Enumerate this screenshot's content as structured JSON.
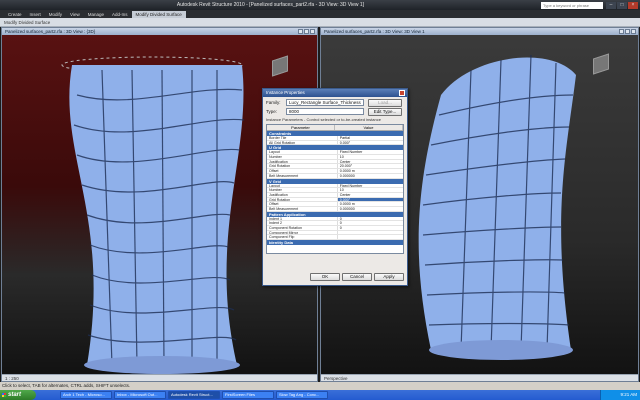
{
  "window": {
    "title": "Autodesk Revit Structure 2010 - [Panelized surfaces_part2.rfa - 3D View: 3D View 1]",
    "search_placeholder": "Type a keyword or phrase"
  },
  "ribbon": {
    "tabs": [
      "Create",
      "Insert",
      "Modify",
      "View",
      "Manage",
      "Add-Ins",
      "Modify Divided Surface"
    ]
  },
  "context_label": "Modify Divided Surface",
  "viewports": {
    "left": {
      "title": "Panelized surfaces_part2.rfa : 3D View : {3D}",
      "scale": "1 : 250"
    },
    "right": {
      "title": "Panelized surfaces_part2.rfa : 3D View: 3D View 1",
      "mode": "Perspective"
    }
  },
  "dialog": {
    "title": "Instance Properties",
    "family_label": "Family:",
    "family_value": "Lucy_Rectangle Surface_Thickness",
    "load_button": "Load...",
    "type_label": "Type:",
    "type_value": "8000",
    "edit_type_button": "Edit Type...",
    "note": "Instance Parameters - Control selected or to-be-created instance",
    "col_parameter": "Parameter",
    "col_value": "Value",
    "sections": [
      {
        "name": "Constraints",
        "rows": [
          {
            "p": "Border Tile",
            "v": "Partial"
          },
          {
            "p": "All Grid Rotation",
            "v": "0.000°"
          }
        ]
      },
      {
        "name": "U Grid",
        "rows": [
          {
            "p": "Layout",
            "v": "Fixed Number"
          },
          {
            "p": "Number",
            "v": "10"
          },
          {
            "p": "Justification",
            "v": "Center"
          },
          {
            "p": "Grid Rotation",
            "v": "20.000°"
          },
          {
            "p": "Offset",
            "v": "0.0000 m"
          },
          {
            "p": "Belt Measurement",
            "v": "0.000000"
          }
        ]
      },
      {
        "name": "V Grid",
        "rows": [
          {
            "p": "Layout",
            "v": "Fixed Number"
          },
          {
            "p": "Number",
            "v": "10"
          },
          {
            "p": "Justification",
            "v": "Center"
          },
          {
            "p": "Grid Rotation",
            "v": "0.000°",
            "selected": true
          },
          {
            "p": "Offset",
            "v": "0.0000 m"
          },
          {
            "p": "Belt Measurement",
            "v": "0.000000"
          }
        ]
      },
      {
        "name": "Pattern Application",
        "rows": [
          {
            "p": "Indent 1",
            "v": "0"
          },
          {
            "p": "Indent 2",
            "v": "0"
          },
          {
            "p": "Component Rotation",
            "v": "0"
          },
          {
            "p": "Component Mirror",
            "v": ""
          },
          {
            "p": "Component Flip",
            "v": ""
          }
        ]
      },
      {
        "name": "Identity Data",
        "rows": []
      }
    ],
    "ok": "OK",
    "cancel": "Cancel",
    "apply": "Apply"
  },
  "status_bar": "Click to select, TAB for alternates, CTRL adds, SHIFT unselects.",
  "taskbar": {
    "start": "start",
    "tasks": [
      "Arch 1 Tech - Microso...",
      "Inbox - Microsoft Out...",
      "Autodesk Revit Struct...",
      "FirstScreen Files",
      "Slow Tag Ang - Conc..."
    ],
    "time": "9:21 AM"
  }
}
